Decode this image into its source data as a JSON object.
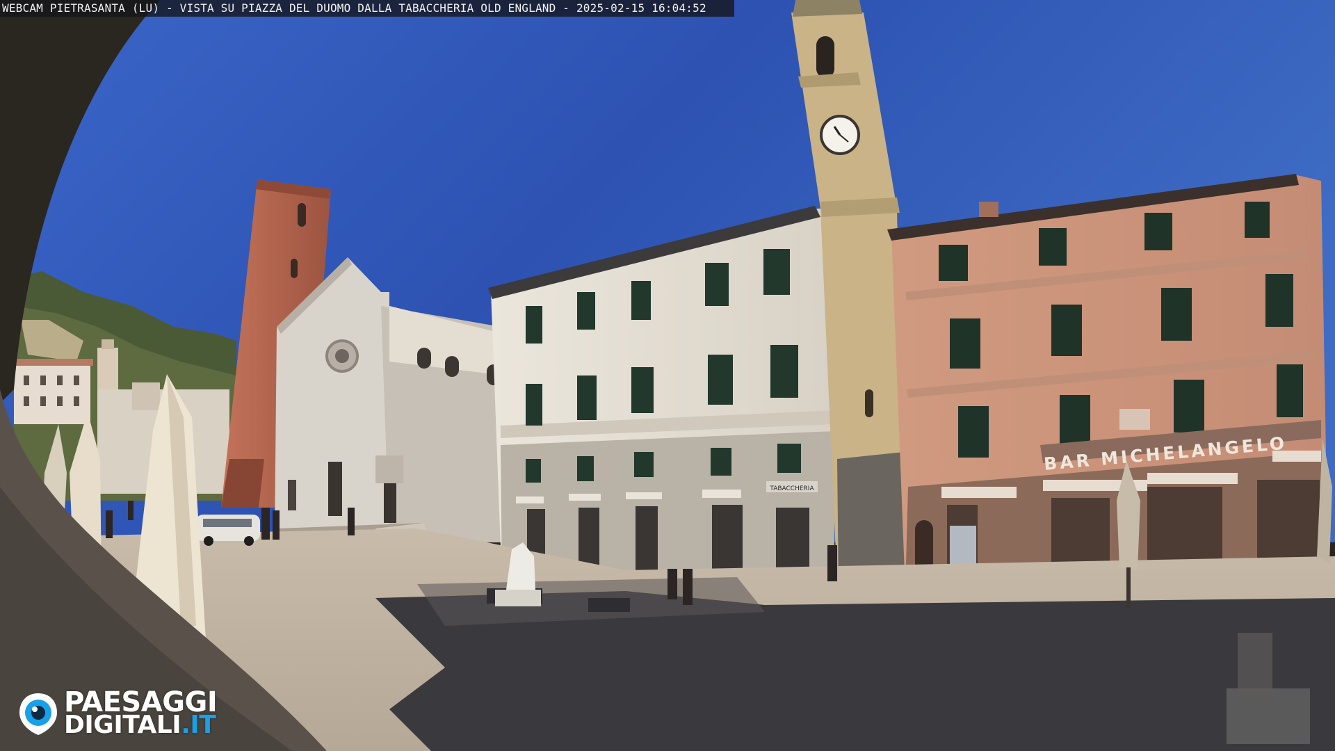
{
  "overlay": {
    "caption": "WEBCAM PIETRASANTA (LU) - VISTA SU PIAZZA DEL DUOMO DALLA TABACCHERIA OLD ENGLAND - 2025-02-15 16:04:52"
  },
  "signs": {
    "bar": "BAR MICHELANGELO",
    "tabaccheria": "TABACCHERIA"
  },
  "logo": {
    "line1": "PAESAGGI",
    "line2_main": "DIGITALI",
    "line2_tld": ".IT"
  },
  "colors": {
    "sky": "#2f55b4",
    "pink_facade": "#d4a28a",
    "cream_facade": "#e2ddd3",
    "brick_tower": "#b9674e",
    "logo_accent": "#1aa0e6"
  }
}
